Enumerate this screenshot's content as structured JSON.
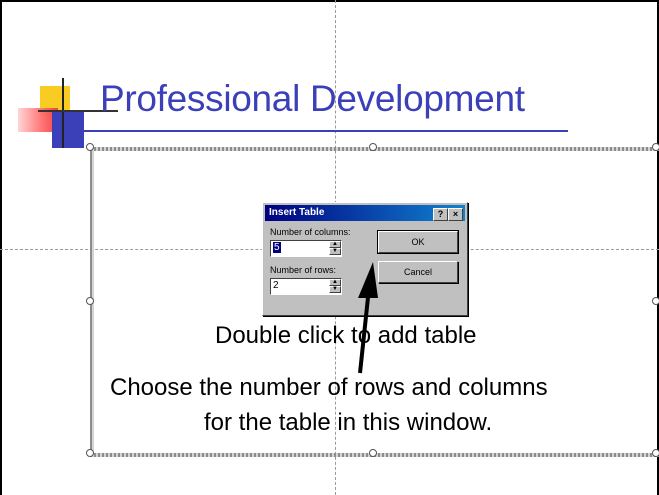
{
  "slide": {
    "title": "Professional Development",
    "title_color": "#3b3fb8",
    "caption_double_click": "Double click to add table",
    "caption_choose_line1": "Choose the number of rows and columns",
    "caption_choose_line2": "for the table in this window."
  },
  "dialog": {
    "title": "Insert Table",
    "help_button": "?",
    "close_button": "×",
    "columns_label": "Number of columns:",
    "columns_value": "5",
    "rows_label": "Number of rows:",
    "rows_value": "2",
    "ok_label": "OK",
    "cancel_label": "Cancel",
    "spin_up_icon": "up-arrow-icon",
    "spin_down_icon": "down-arrow-icon"
  },
  "colors": {
    "title_bar_start": "#000080",
    "title_bar_end": "#1084d0",
    "dialog_face": "#c0c0c0"
  }
}
